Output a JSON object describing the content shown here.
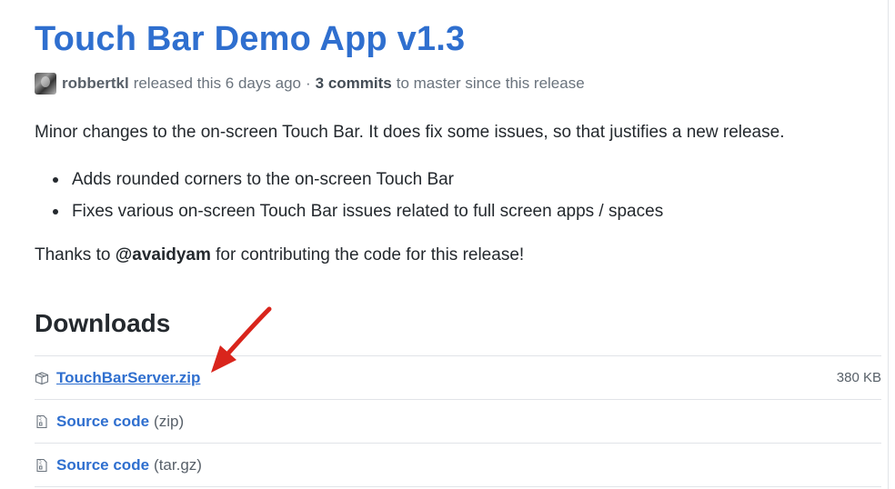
{
  "release": {
    "title": "Touch Bar Demo App v1.3",
    "author": "robbertkl",
    "released_text": "released this 6 days ago",
    "separator": "·",
    "commits": "3 commits",
    "commits_suffix": "to master since this release"
  },
  "body": {
    "description": "Minor changes to the on-screen Touch Bar. It does fix some issues, so that justifies a new release.",
    "bullets": [
      "Adds rounded corners to the on-screen Touch Bar",
      "Fixes various on-screen Touch Bar issues related to full screen apps / spaces"
    ],
    "thanks_prefix": "Thanks to",
    "thanks_mention": "@avaidyam",
    "thanks_suffix": "for contributing the code for this release!"
  },
  "downloads": {
    "heading": "Downloads",
    "items": [
      {
        "name": "TouchBarServer.zip",
        "ext": "",
        "size": "380 KB",
        "icon": "package-icon"
      },
      {
        "name": "Source code",
        "ext": "(zip)",
        "size": "",
        "icon": "file-zip-icon"
      },
      {
        "name": "Source code",
        "ext": "(tar.gz)",
        "size": "",
        "icon": "file-zip-icon"
      }
    ]
  },
  "colors": {
    "link": "#2f6fcf",
    "arrow": "#d9251c",
    "muted": "#6a737d"
  }
}
